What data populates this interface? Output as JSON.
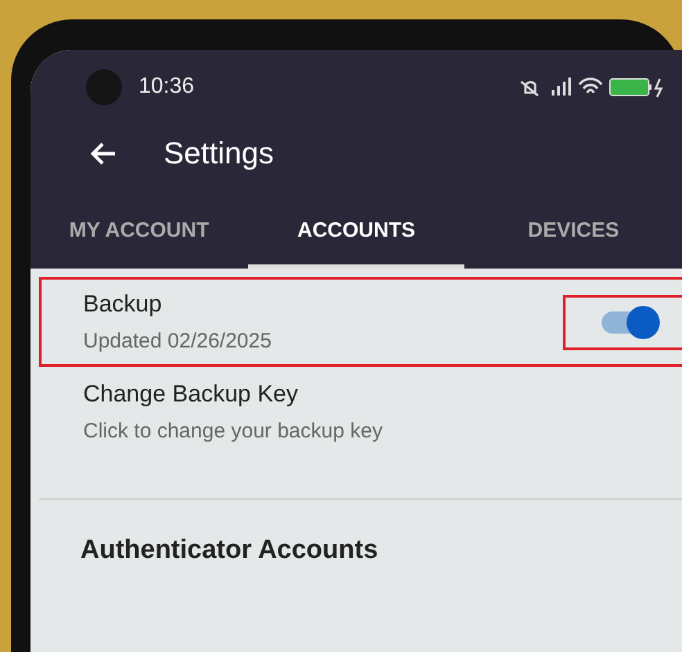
{
  "status_bar": {
    "time": "10:36"
  },
  "header": {
    "title": "Settings"
  },
  "tabs": [
    {
      "label": "MY ACCOUNT",
      "selected": false
    },
    {
      "label": "ACCOUNTS",
      "selected": true
    },
    {
      "label": "DEVICES",
      "selected": false
    }
  ],
  "settings": [
    {
      "kind": "toggle",
      "title": "Backup",
      "subtitle": "Updated 02/26/2025",
      "on": true,
      "highlighted": true
    },
    {
      "kind": "link",
      "title": "Change Backup Key",
      "subtitle": "Click to change your backup key",
      "highlighted": false
    }
  ],
  "section": {
    "title": "Authenticator Accounts"
  }
}
